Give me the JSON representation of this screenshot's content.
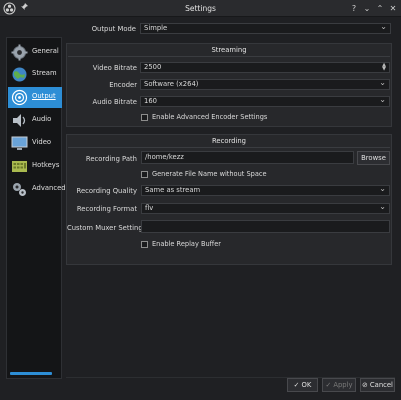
{
  "window": {
    "title": "Settings"
  },
  "titlebar_buttons": [
    "?",
    "⌄",
    "⌃",
    "✕"
  ],
  "sidebar": {
    "items": [
      {
        "label": "General",
        "icon": "gear-icon"
      },
      {
        "label": "Stream",
        "icon": "globe-icon"
      },
      {
        "label": "Output",
        "icon": "output-icon"
      },
      {
        "label": "Audio",
        "icon": "speaker-icon"
      },
      {
        "label": "Video",
        "icon": "monitor-icon"
      },
      {
        "label": "Hotkeys",
        "icon": "keyboard-icon"
      },
      {
        "label": "Advanced",
        "icon": "gears-icon"
      }
    ],
    "active_index": 2
  },
  "output_mode": {
    "label": "Output Mode",
    "value": "Simple"
  },
  "streaming": {
    "title": "Streaming",
    "video_bitrate": {
      "label": "Video Bitrate",
      "value": "2500"
    },
    "encoder": {
      "label": "Encoder",
      "value": "Software (x264)"
    },
    "audio_bitrate": {
      "label": "Audio Bitrate",
      "value": "160"
    },
    "advanced_encoder": {
      "label": "Enable Advanced Encoder Settings",
      "checked": false
    }
  },
  "recording": {
    "title": "Recording",
    "path": {
      "label": "Recording Path",
      "value": "/home/kezz"
    },
    "browse_label": "Browse",
    "no_space": {
      "label": "Generate File Name without Space",
      "checked": false
    },
    "quality": {
      "label": "Recording Quality",
      "value": "Same as stream"
    },
    "format": {
      "label": "Recording Format",
      "value": "flv"
    },
    "muxer": {
      "label": "Custom Muxer Settings",
      "value": ""
    },
    "replay_buffer": {
      "label": "Enable Replay Buffer",
      "checked": false
    }
  },
  "footer": {
    "ok_label": "✓ OK",
    "apply_label": "✓ Apply",
    "cancel_label": "⊘ Cancel"
  },
  "colors": {
    "accent": "#2d8ed6",
    "background": "#1f2023",
    "panel": "#27282b"
  }
}
